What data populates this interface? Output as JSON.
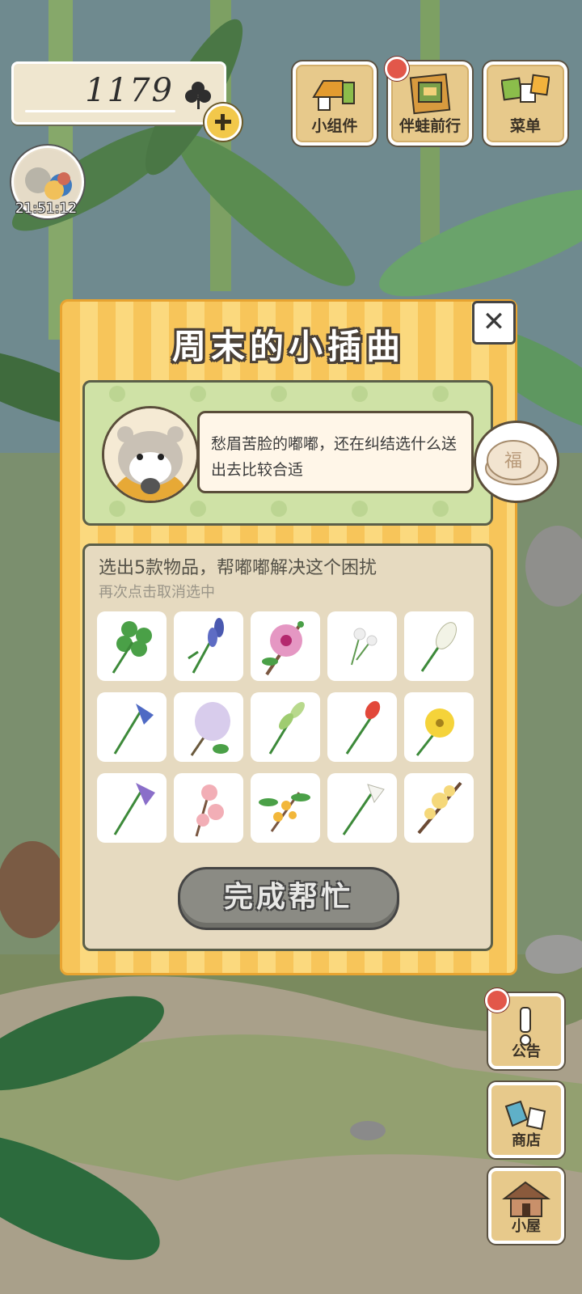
{
  "hud": {
    "clover_count": "1179",
    "clover_icon": "clover-icon",
    "add_icon": "plus-icon",
    "timer": "21:51:12"
  },
  "top_buttons": [
    {
      "label": "小组件",
      "icon": "widget-icon"
    },
    {
      "label": "伴蛙前行",
      "icon": "frog-journey-icon",
      "badge": true
    },
    {
      "label": "菜单",
      "icon": "menu-icon"
    }
  ],
  "dialog": {
    "title": "周末的小插曲",
    "close_icon": "close-icon",
    "speech": "愁眉苦脸的嘟嘟，还在纠结选什么送出去比较合适",
    "instruction": "选出5款物品，帮嘟嘟解决这个困扰",
    "sub_instruction": "再次点击取消选中",
    "items": [
      {
        "icon": "four-leaf-clover-icon"
      },
      {
        "icon": "iris-icon"
      },
      {
        "icon": "hibiscus-icon"
      },
      {
        "icon": "dandelion-icon"
      },
      {
        "icon": "white-hyacinth-icon"
      },
      {
        "icon": "bellflower-icon"
      },
      {
        "icon": "lilac-icon"
      },
      {
        "icon": "green-lily-icon"
      },
      {
        "icon": "tulip-icon"
      },
      {
        "icon": "buttercup-icon"
      },
      {
        "icon": "purple-bellflower-icon"
      },
      {
        "icon": "peach-blossom-icon"
      },
      {
        "icon": "osmanthus-icon"
      },
      {
        "icon": "white-lily-icon"
      },
      {
        "icon": "wintersweet-icon"
      }
    ],
    "finish_label": "完成帮忙"
  },
  "side_buttons": [
    {
      "label": "公告",
      "icon": "notice-icon",
      "badge": true
    },
    {
      "label": "商店",
      "icon": "shop-icon"
    },
    {
      "label": "小屋",
      "icon": "house-icon"
    }
  ],
  "colors": {
    "dialog_stripe_a": "#f7c55a",
    "dialog_stripe_b": "#fbd97e",
    "story_green": "#cfe2a6",
    "panel_beige": "#e6dac0",
    "button_grey": "#8b8b84",
    "badge_red": "#e2574a"
  }
}
